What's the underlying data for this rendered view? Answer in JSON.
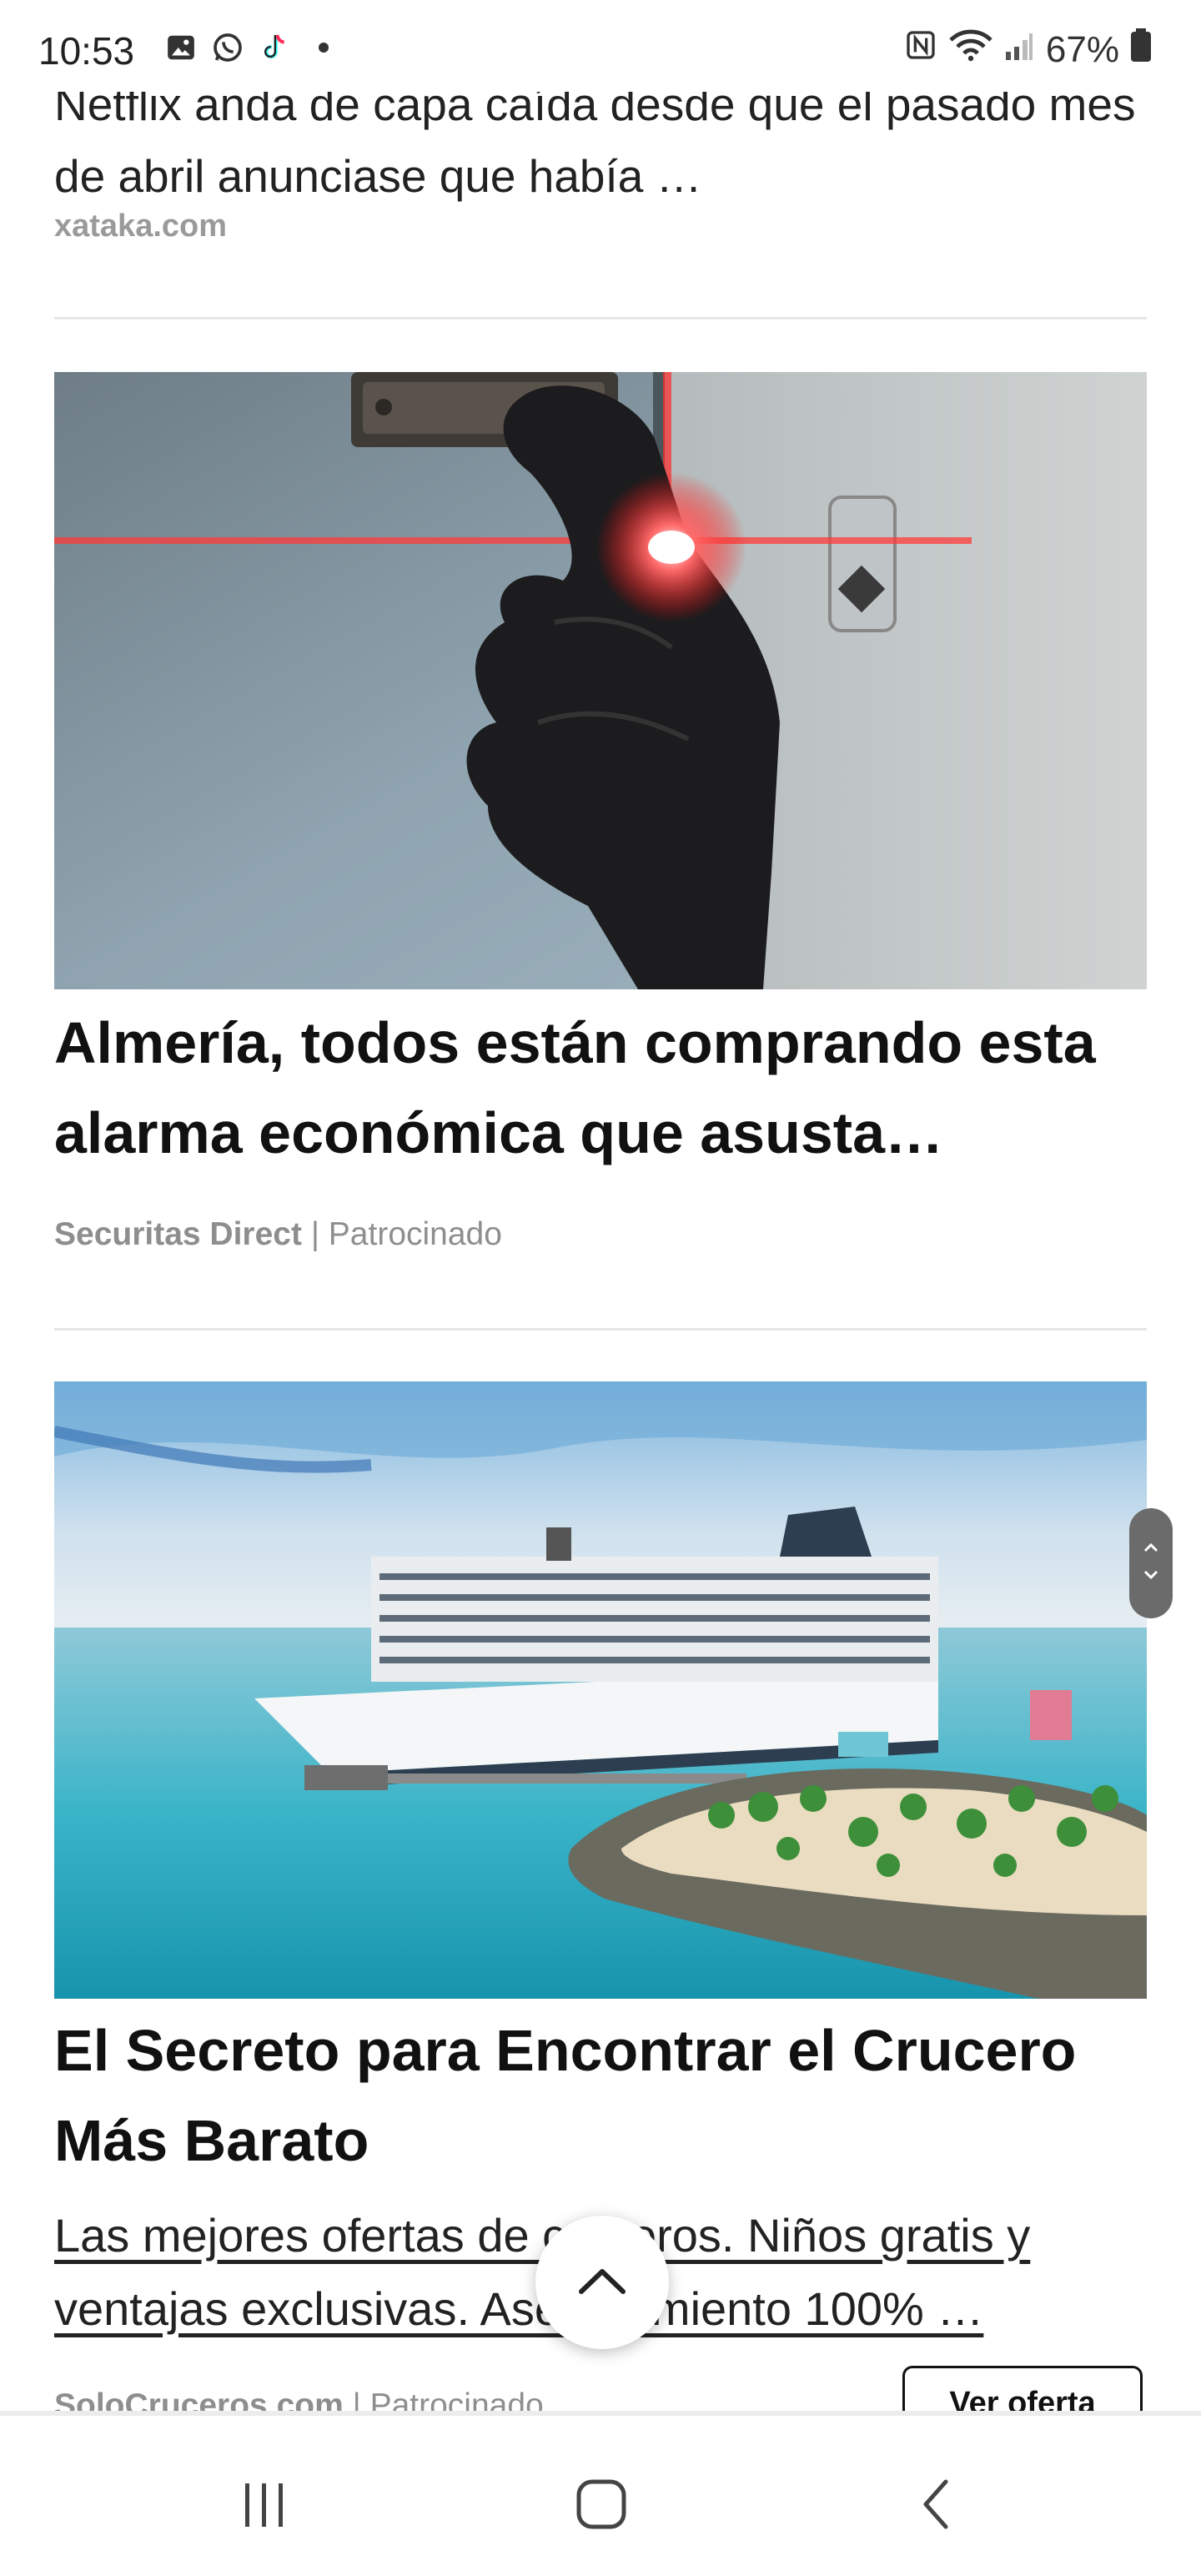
{
  "status_bar": {
    "time": "10:53",
    "battery": "67%",
    "icons": [
      "gallery-icon",
      "whatsapp-icon",
      "tiktok-icon",
      "nfc-icon",
      "wifi-icon",
      "signal-icon",
      "battery-icon"
    ]
  },
  "previous_item": {
    "teaser": "Netflix anda de capa caída desde que el pasado mes de abril anunciase que había …",
    "source": "xataka.com"
  },
  "card1": {
    "title": "Almería, todos están comprando esta alarma económica que asusta…",
    "source": "Securitas Direct",
    "sponsor_label": "Patrocinado",
    "image_alt": "gloved hand cutting door chain with red laser"
  },
  "card2": {
    "title": "El Secreto para Encontrar el Crucero Más Barato",
    "description": "Las mejores ofertas de cruceros. Niños gratis y ventajas exclusivas. Asesoramiento 100% …",
    "source": "SoloCruceros.com",
    "sponsor_label": "Patrocinado",
    "cta": "Ver oferta",
    "image_alt": "cruise ship docked at tropical island"
  },
  "controls": {
    "scroll_top_icon": "chevron-up-icon",
    "scroll_handle_icons": [
      "chevron-up-icon",
      "chevron-down-icon"
    ]
  },
  "nav": {
    "icons": [
      "recents-icon",
      "home-icon",
      "back-icon"
    ]
  },
  "colors": {
    "accent_laser": "#ff2a2a",
    "sea": "#1fa6c2",
    "sky": "#5aa8df"
  }
}
